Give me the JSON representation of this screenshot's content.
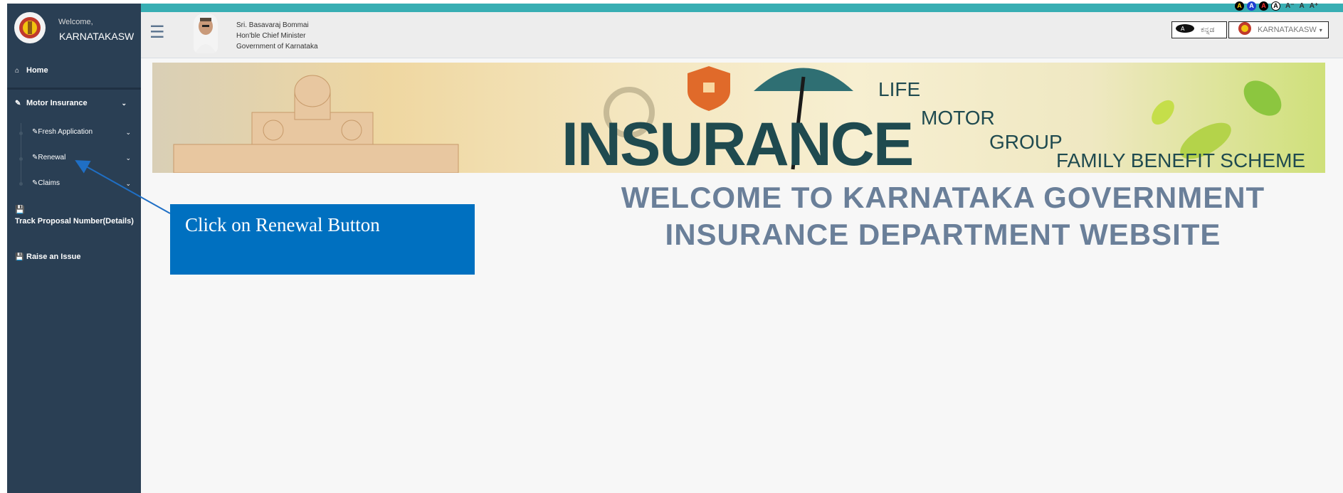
{
  "sidebar": {
    "welcome": "Welcome,",
    "username": "KARNATAKASW",
    "items": [
      {
        "label": "Home"
      },
      {
        "label": "Motor Insurance"
      },
      {
        "label": "Fresh Application"
      },
      {
        "label": "Renewal"
      },
      {
        "label": "Claims"
      },
      {
        "label": "Track Proposal Number(Details)"
      },
      {
        "label": "Raise an Issue"
      }
    ]
  },
  "header": {
    "cm_name": "Sri. Basavaraj Bommai",
    "cm_title": "Hon'ble Chief Minister",
    "cm_gov": "Government of Karnataka",
    "accessibility": [
      "A",
      "A",
      "A",
      "A"
    ],
    "font_sizes": [
      "A⁻",
      "A",
      "A⁺"
    ],
    "language": "ಕನ್ನಡ",
    "user": "KARNATAKASW"
  },
  "banner": {
    "main_word": "INSURANCE",
    "tags": [
      "LIFE",
      "MOTOR",
      "GROUP",
      "FAMILY BENEFIT SCHEME"
    ]
  },
  "main": {
    "welcome_line1": "WELCOME TO KARNATAKA GOVERNMENT",
    "welcome_line2": "INSURANCE DEPARTMENT WEBSITE"
  },
  "callout": {
    "text": "Click on Renewal Button"
  },
  "colors": {
    "sidebar_bg": "#2a3f54",
    "accent": "#1abb9c",
    "teal_strip": "#38aeb3",
    "callout_bg": "#0070c0",
    "welcome_text": "#6a7f99"
  }
}
